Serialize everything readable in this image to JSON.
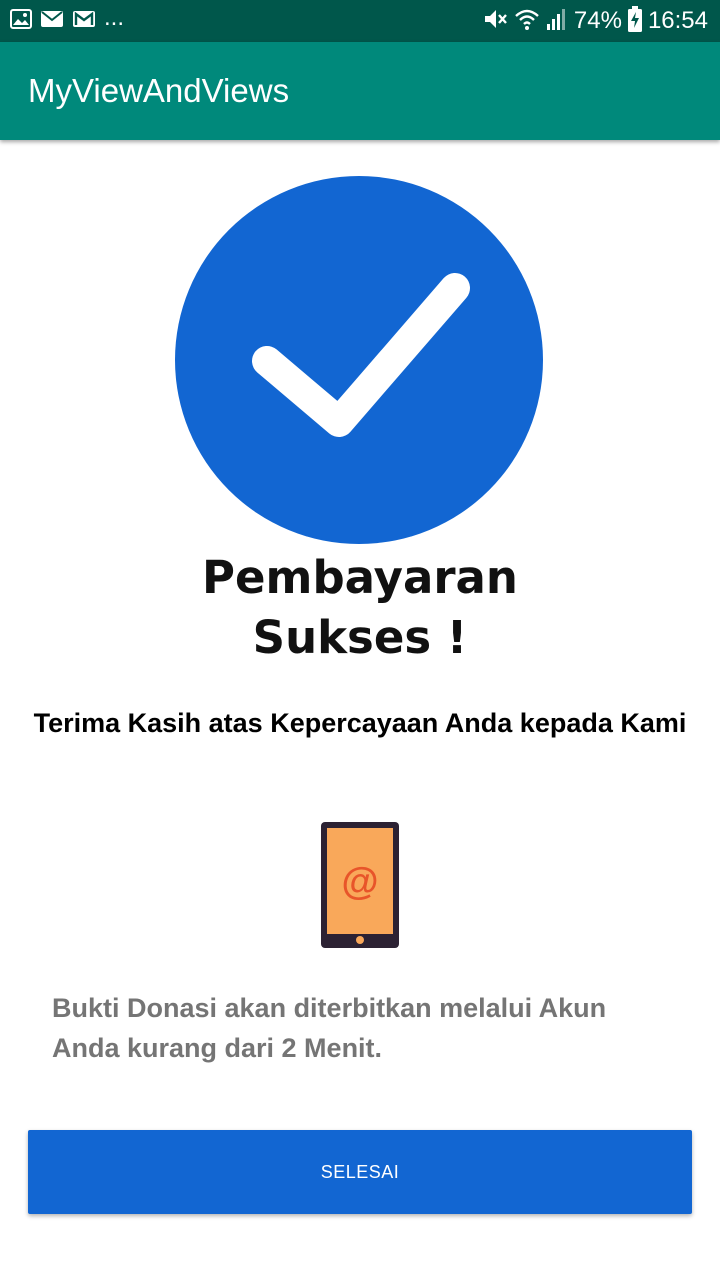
{
  "status_bar": {
    "left_icons": [
      "image-icon",
      "mail-icon",
      "gmail-icon"
    ],
    "overflow": "...",
    "right_icons": [
      "mute-icon",
      "wifi-icon",
      "signal-icon",
      "battery-charging-icon"
    ],
    "battery": "74%",
    "time": "16:54"
  },
  "app_bar": {
    "title": "MyViewAndViews"
  },
  "success": {
    "icon": "check-circle-icon",
    "title_line1": "Pembayaran",
    "title_line2": "Sukses !"
  },
  "thanks": "Terima Kasih atas Kepercayaan Anda kepada Kami",
  "phone": {
    "icon": "phone-email-icon",
    "symbol": "@"
  },
  "info": "Bukti Donasi akan diterbitkan melalui Akun Anda kurang dari 2 Menit.",
  "button": {
    "label": "SELESAI"
  },
  "colors": {
    "status_bar": "#00574b",
    "app_bar": "#00897b",
    "accent_blue": "#1266d2",
    "phone_screen": "#f9a85a",
    "phone_body": "#2c2233",
    "at_symbol": "#e8552a"
  }
}
